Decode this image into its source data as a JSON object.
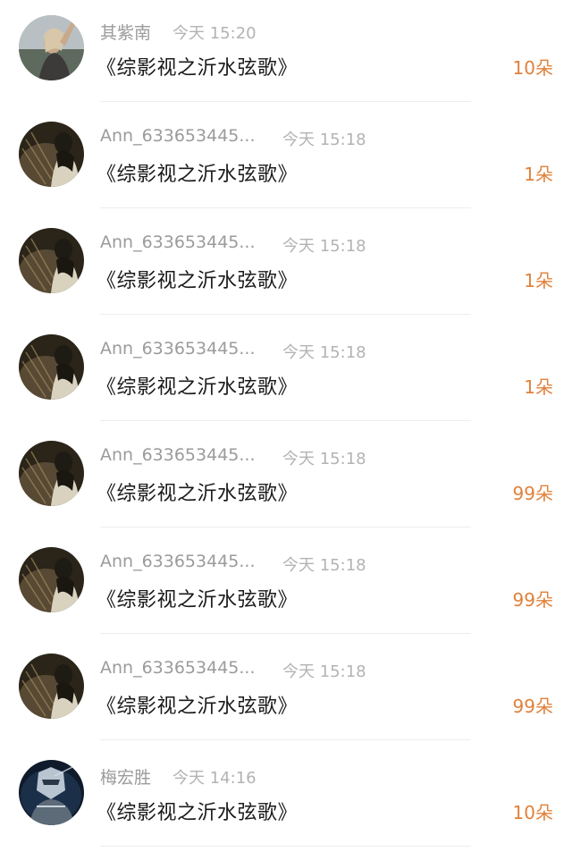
{
  "colors": {
    "username": "#9b9b9b",
    "timestamp": "#b3b3b3",
    "title": "#1a1a1a",
    "gift_count": "#e0813b",
    "divider": "#ededed"
  },
  "items": [
    {
      "avatar": "user-avatar-woman-outdoors",
      "username": "其紫南",
      "timestamp": "今天 15:20",
      "title": "《综影视之沂水弦歌》",
      "gift": "10朵"
    },
    {
      "avatar": "user-avatar-dark-silhouette",
      "username": "Ann_633653445...",
      "timestamp": "今天 15:18",
      "title": "《综影视之沂水弦歌》",
      "gift": "1朵"
    },
    {
      "avatar": "user-avatar-dark-silhouette",
      "username": "Ann_633653445...",
      "timestamp": "今天 15:18",
      "title": "《综影视之沂水弦歌》",
      "gift": "1朵"
    },
    {
      "avatar": "user-avatar-dark-silhouette",
      "username": "Ann_633653445...",
      "timestamp": "今天 15:18",
      "title": "《综影视之沂水弦歌》",
      "gift": "1朵"
    },
    {
      "avatar": "user-avatar-dark-silhouette",
      "username": "Ann_633653445...",
      "timestamp": "今天 15:18",
      "title": "《综影视之沂水弦歌》",
      "gift": "99朵"
    },
    {
      "avatar": "user-avatar-dark-silhouette",
      "username": "Ann_633653445...",
      "timestamp": "今天 15:18",
      "title": "《综影视之沂水弦歌》",
      "gift": "99朵"
    },
    {
      "avatar": "user-avatar-dark-silhouette",
      "username": "Ann_633653445...",
      "timestamp": "今天 15:18",
      "title": "《综影视之沂水弦歌》",
      "gift": "99朵"
    },
    {
      "avatar": "user-avatar-armored-figure",
      "username": "梅宏胜",
      "timestamp": "今天 14:16",
      "title": "《综影视之沂水弦歌》",
      "gift": "10朵"
    }
  ]
}
